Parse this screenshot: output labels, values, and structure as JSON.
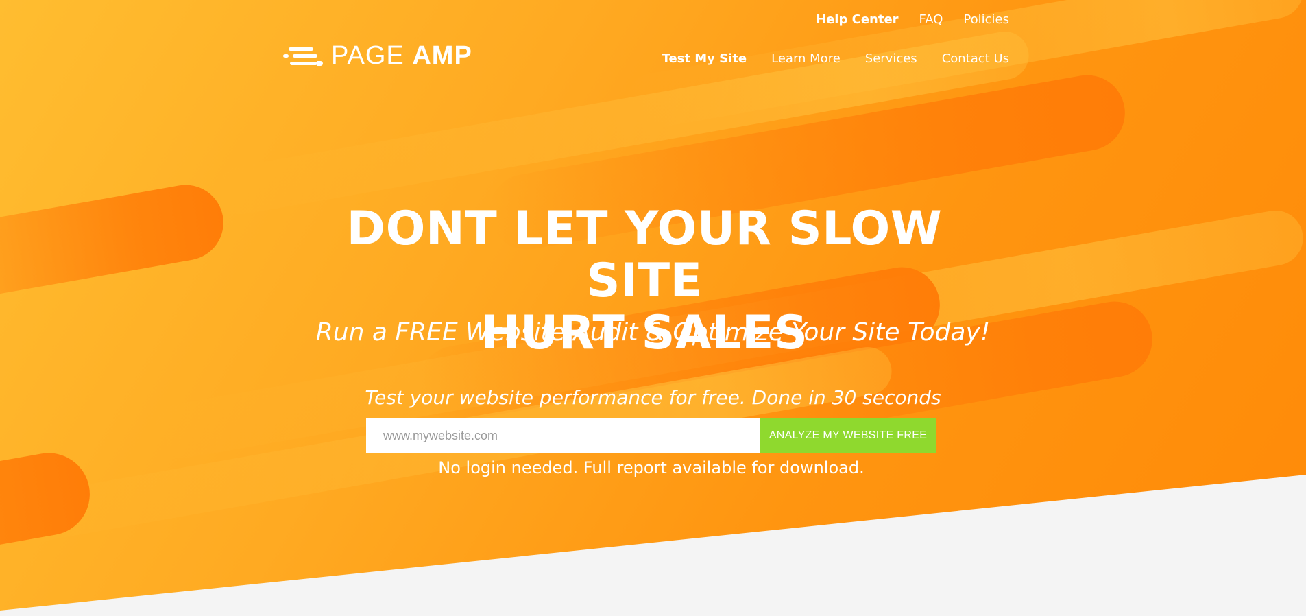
{
  "brand": {
    "logo_left": "PAGE",
    "logo_right": "AMP"
  },
  "top_nav": [
    {
      "label": "Help Center"
    },
    {
      "label": "FAQ"
    },
    {
      "label": "Policies"
    }
  ],
  "main_nav": [
    {
      "label": "Test My Site"
    },
    {
      "label": "Learn More"
    },
    {
      "label": "Services"
    },
    {
      "label": "Contact Us"
    }
  ],
  "hero": {
    "headline_line1": "DONT LET YOUR SLOW SITE",
    "headline_line2": "HURT SALES",
    "subhead": "Run a FREE Website Audit & Optimize Your Site Today!",
    "tagline": "Test your website performance for free. Done in 30 seconds",
    "url_placeholder": "www.mywebsite.com",
    "url_value": "",
    "cta_label": "ANALYZE MY WEBSITE FREE",
    "note": "No login needed. Full report available for download."
  },
  "colors": {
    "hero_start": "#ffbd30",
    "hero_end": "#ff8a08",
    "cta": "#8fd92e",
    "page_bg": "#f4f4f4"
  }
}
